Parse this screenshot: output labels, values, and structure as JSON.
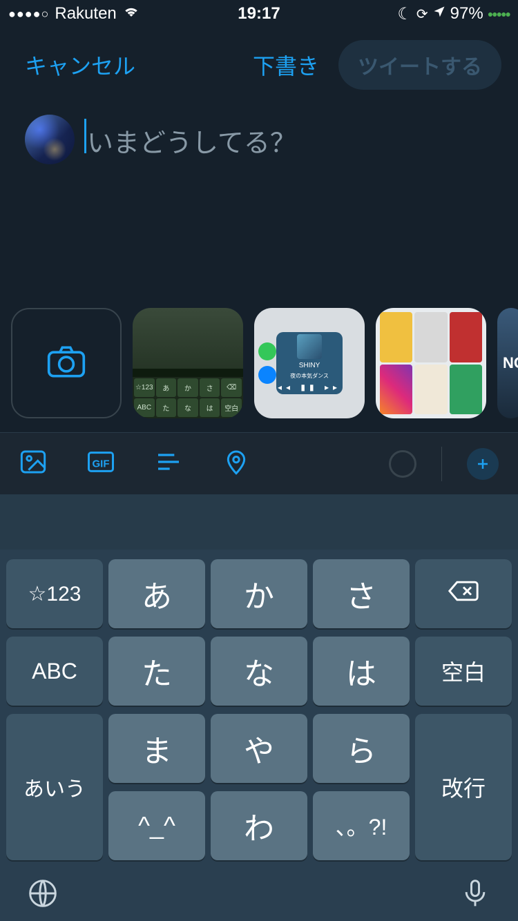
{
  "status": {
    "signal_dots": "●●●●○",
    "carrier": "Rakuten",
    "time": "19:17",
    "battery_pct": "97%",
    "battery_dots": "●●●●●"
  },
  "header": {
    "cancel": "キャンセル",
    "draft": "下書き",
    "tweet": "ツイートする"
  },
  "compose": {
    "placeholder": "いまどうしてる？"
  },
  "media": {
    "thumb1_keys": [
      "☆123",
      "あ",
      "か",
      "さ",
      "⌫",
      "ABC",
      "た",
      "な",
      "は",
      "空白"
    ],
    "thumb2_song": "SHINY",
    "thumb2_artist": "夜の本気ダンス",
    "thumb4_text": "NC"
  },
  "toolbar": {
    "gif_label": "GIF"
  },
  "keyboard": {
    "r1": [
      "☆123",
      "あ",
      "か",
      "さ"
    ],
    "delete_icon": "⌫",
    "r2": [
      "ABC",
      "た",
      "な",
      "は",
      "空白"
    ],
    "r3_left": "あいう",
    "r3": [
      "ま",
      "や",
      "ら"
    ],
    "enter": "改行",
    "r4": [
      "^_^",
      "わ",
      "、。?!"
    ]
  }
}
